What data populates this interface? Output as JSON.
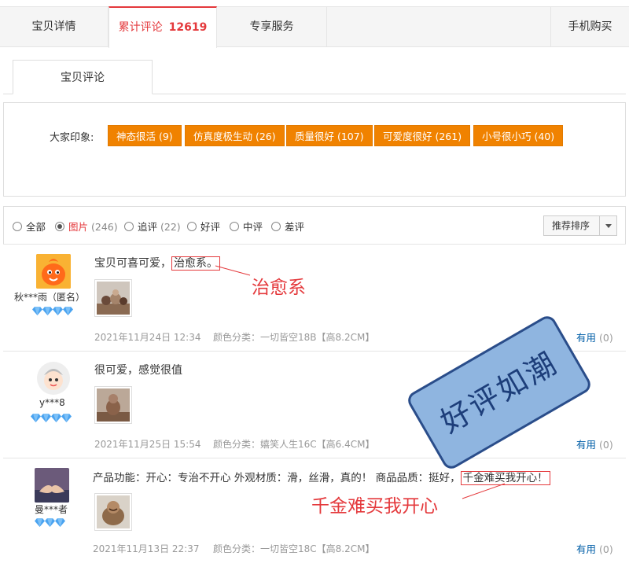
{
  "top_tabs": {
    "details": "宝贝详情",
    "reviews_label": "累计评论",
    "reviews_count": "12619",
    "service": "专享服务",
    "mobile": "手机购买"
  },
  "sub_tab": "宝贝评论",
  "impressions": {
    "label": "大家印象:",
    "tags": [
      "神态很活 (9)",
      "仿真度极生动 (26)",
      "质量很好 (107)",
      "可爱度很好 (261)",
      "小号很小巧 (40)"
    ]
  },
  "filters": {
    "all": "全部",
    "pics_label": "图片",
    "pics_count": "(246)",
    "followup_label": "追评",
    "followup_count": "(22)",
    "good": "好评",
    "neutral": "中评",
    "bad": "差评",
    "sort": "推荐排序"
  },
  "reviews": [
    {
      "user": "秋***雨（匿名）",
      "text_before": "宝贝可喜可爱，",
      "text_highlight": "治愈系。",
      "date": "2021年11月24日 12:34",
      "variant": "颜色分类：一切皆空18B【高8.2CM】",
      "useful": "有用",
      "useful_count": "(0)"
    },
    {
      "user": "y***8",
      "text": "很可爱，感觉很值",
      "date": "2021年11月25日 15:54",
      "variant": "颜色分类：嬉笑人生16C【高6.4CM】",
      "useful": "有用",
      "useful_count": "(0)"
    },
    {
      "user": "曼***者",
      "text_before": "产品功能：开心：专治不开心 外观材质：滑，丝滑，真的！ 商品品质：挺好，",
      "text_highlight": "千金难买我开心！",
      "date": "2021年11月13日 22:37",
      "variant": "颜色分类：一切皆空18C【高8.2CM】",
      "useful": "有用",
      "useful_count": "(0)"
    }
  ],
  "annotations": {
    "label1": "治愈系",
    "label2": "千金难买我开心",
    "stamp": "好评如潮"
  },
  "colors": {
    "accent_red": "#e4393c",
    "tag_orange": "#f08200",
    "stamp_blue": "#8fb5e0"
  }
}
